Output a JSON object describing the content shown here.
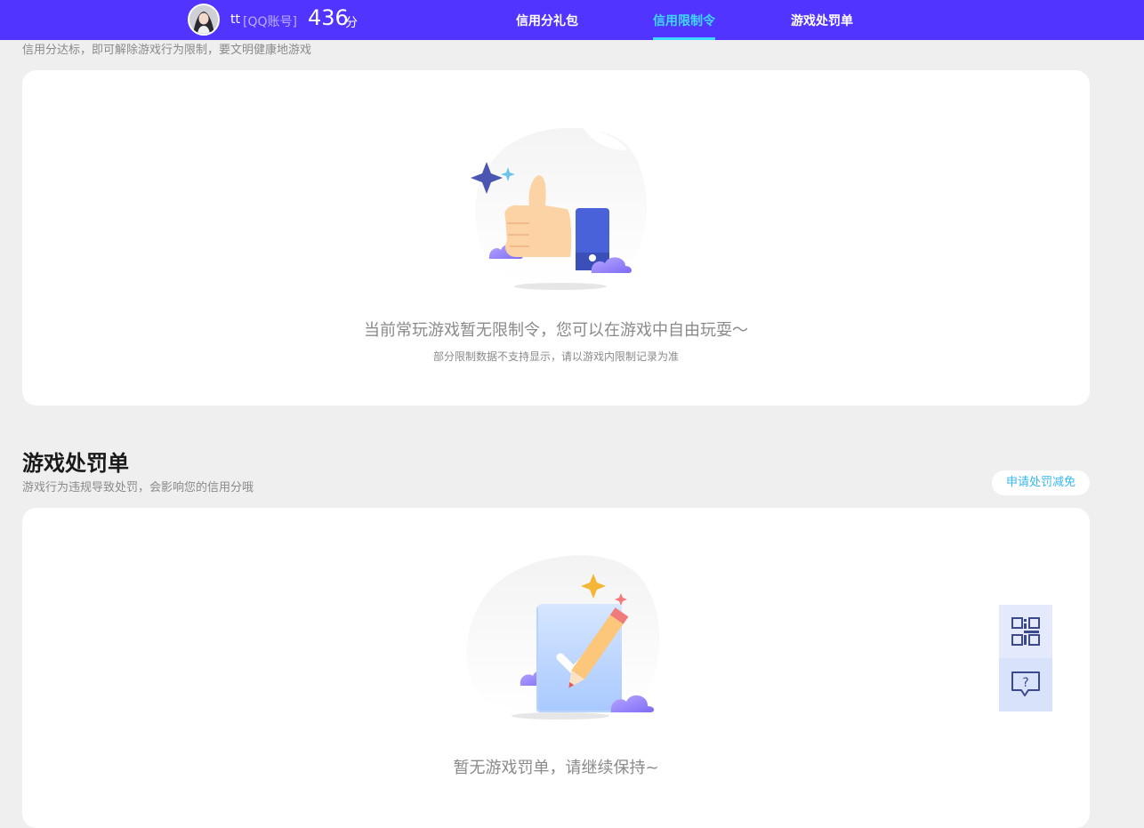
{
  "header": {
    "user_name": "tt",
    "account_type": "[QQ账号]",
    "score": "436",
    "score_unit": "分",
    "tabs": [
      {
        "label": "信用分礼包",
        "active": false
      },
      {
        "label": "信用限制令",
        "active": true
      },
      {
        "label": "游戏处罚单",
        "active": false
      }
    ]
  },
  "restriction": {
    "subtitle": "信用分达标，即可解除游戏行为限制，要文明健康地游戏",
    "empty_title": "当前常玩游戏暂无限制令，您可以在游戏中自由玩耍～",
    "empty_note": "部分限制数据不支持显示，请以游戏内限制记录为准"
  },
  "penalty": {
    "title": "游戏处罚单",
    "subtitle": "游戏行为违规导致处罚，会影响您的信用分哦",
    "apply_button": "申请处罚减免",
    "empty_title": "暂无游戏罚单，请继续保持~"
  },
  "float_tools": [
    {
      "icon": "qr-code-icon"
    },
    {
      "icon": "feedback-question-icon"
    }
  ],
  "colors": {
    "brand": "#5134ff",
    "active_tab": "#3fd8ff",
    "link": "#37b8f0"
  }
}
